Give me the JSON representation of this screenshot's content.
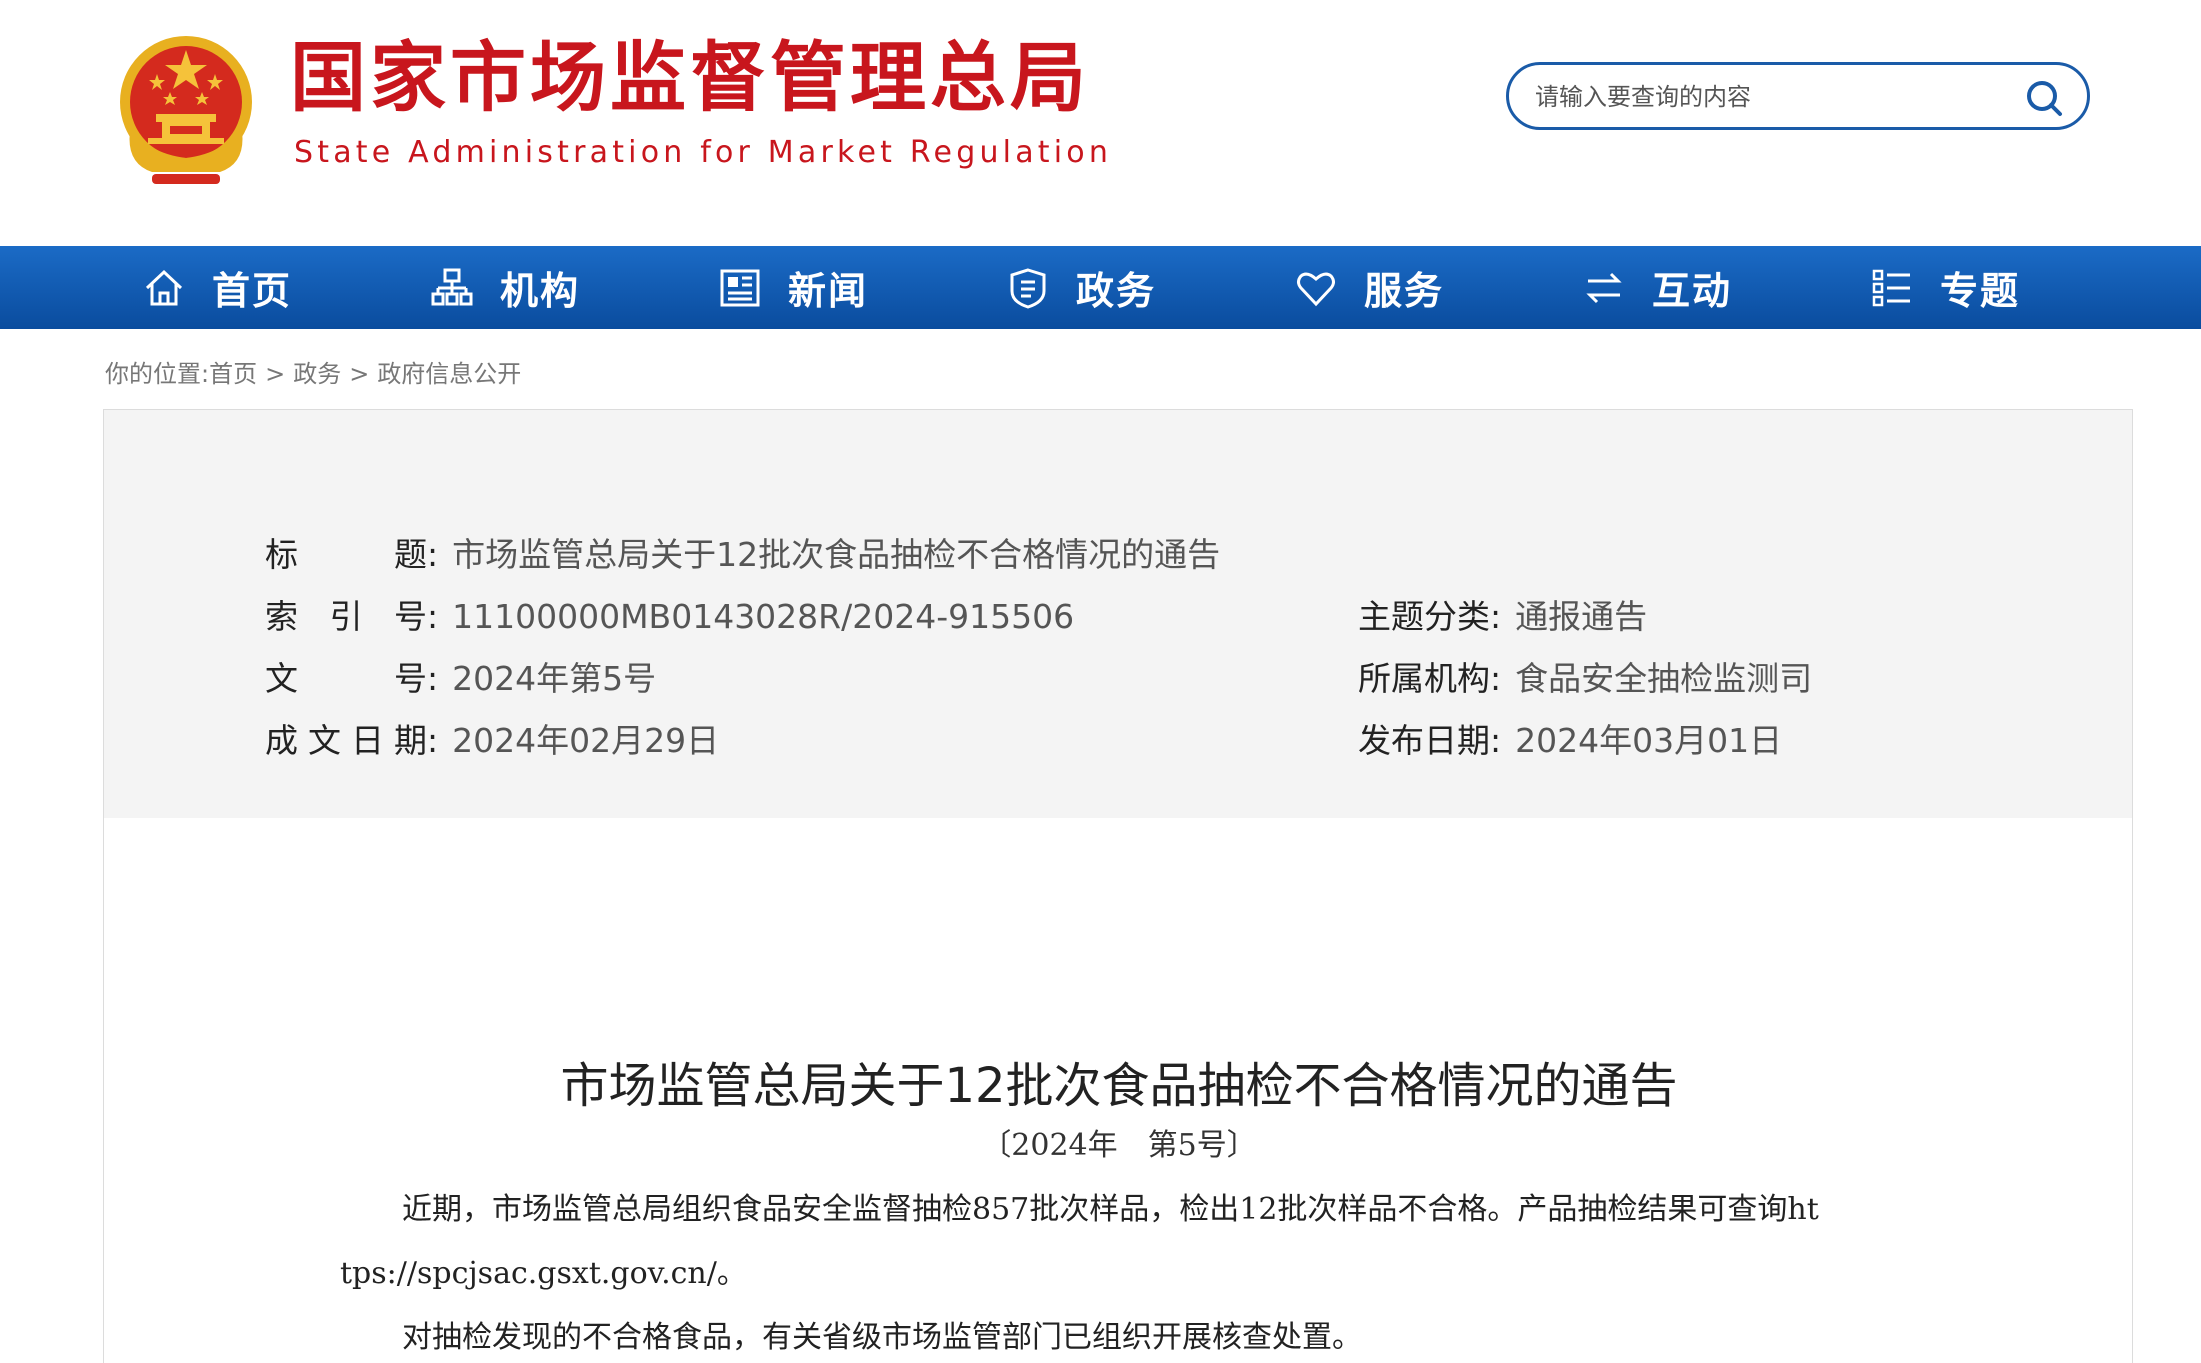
{
  "header": {
    "title": "国家市场监督管理总局",
    "subtitle": "State Administration for Market Regulation",
    "search_placeholder": "请输入要查询的内容",
    "brand_red": "#c8161d",
    "brand_blue": "#1a5ba8"
  },
  "nav": {
    "items": [
      {
        "label": "首页",
        "icon": "home-icon"
      },
      {
        "label": "机构",
        "icon": "org-chart-icon"
      },
      {
        "label": "新闻",
        "icon": "newspaper-icon"
      },
      {
        "label": "政务",
        "icon": "shield-icon"
      },
      {
        "label": "服务",
        "icon": "heart-icon"
      },
      {
        "label": "互动",
        "icon": "exchange-arrows-icon"
      },
      {
        "label": "专题",
        "icon": "topic-list-icon"
      }
    ]
  },
  "breadcrumb": {
    "prefix": "你的位置:",
    "items": [
      "首页",
      "政务",
      "政府信息公开"
    ],
    "separator": ">"
  },
  "info": {
    "title_label": "标题",
    "title_value": "市场监管总局关于12批次食品抽检不合格情况的通告",
    "index_label": "索引号",
    "index_value": "11100000MB0143028R/2024-915506",
    "topic_label": "主题分类",
    "topic_value": "通报通告",
    "docno_label": "文号",
    "docno_value": "2024年第5号",
    "org_label": "所属机构",
    "org_value": "食品安全抽检监测司",
    "written_label": "成文日期",
    "written_value": "2024年02月29日",
    "published_label": "发布日期",
    "published_value": "2024年03月01日"
  },
  "article": {
    "title": "市场监管总局关于12批次食品抽检不合格情况的通告",
    "number": "〔2024年　第5号〕",
    "p1_line1": "近期，市场监管总局组织食品安全监督抽检857批次样品，检出12批次样品不合格。产品抽检结果可查询ht",
    "p1_line2": "tps://spcjsac.gsxt.gov.cn/。",
    "p2": "对抽检发现的不合格食品，有关省级市场监管部门已组织开展核查处置。"
  }
}
